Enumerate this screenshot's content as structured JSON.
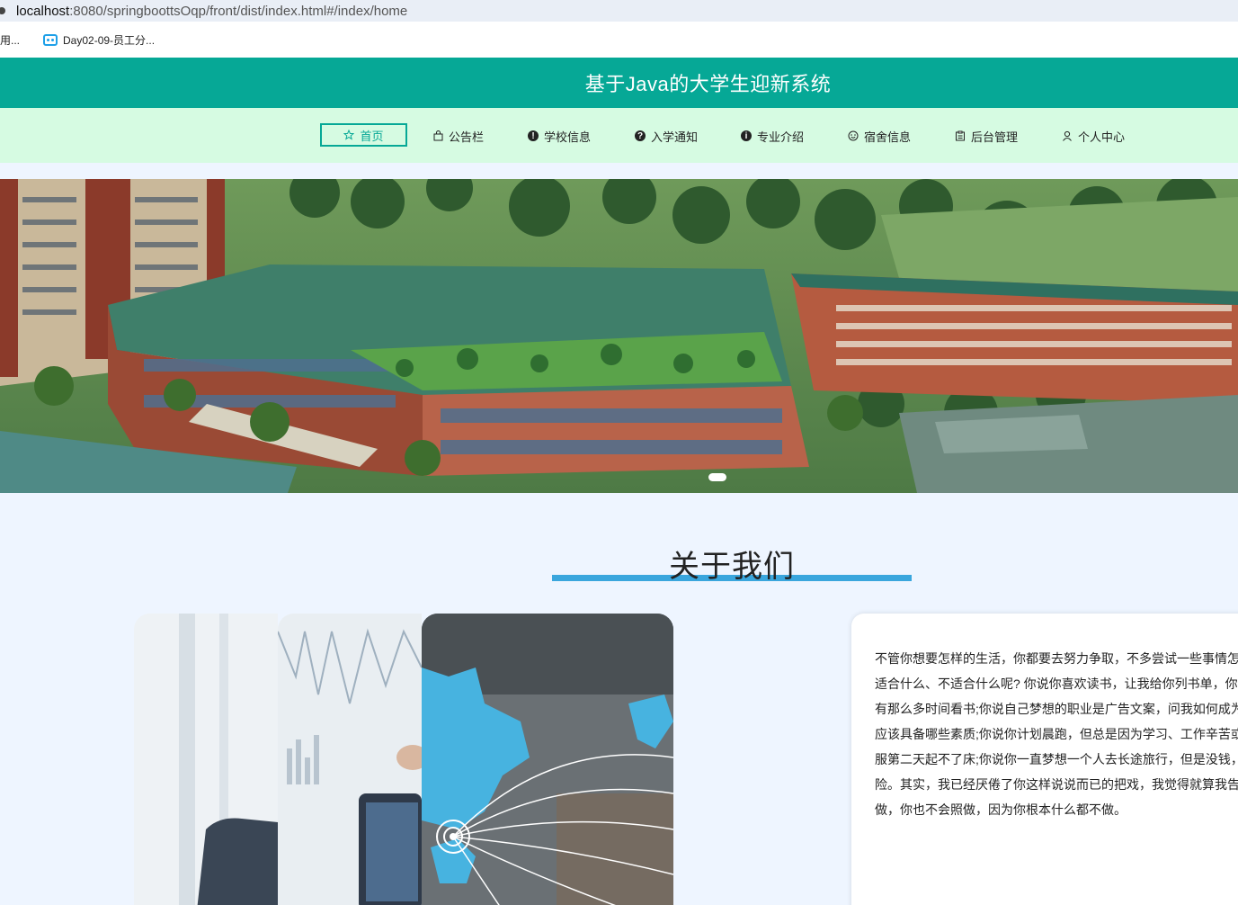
{
  "browser": {
    "url_host": "localhost",
    "url_rest": ":8080/springboottsOqp/front/dist/index.html#/index/home",
    "bookmarks": [
      "用...",
      "Day02-09-员工分..."
    ]
  },
  "header": {
    "title": "基于Java的大学生迎新系统"
  },
  "nav": {
    "items": [
      {
        "label": "首页",
        "icon": "star-icon",
        "active": true
      },
      {
        "label": "公告栏",
        "icon": "bag-icon"
      },
      {
        "label": "学校信息",
        "icon": "info-icon"
      },
      {
        "label": "入学通知",
        "icon": "question-icon"
      },
      {
        "label": "专业介绍",
        "icon": "info-icon"
      },
      {
        "label": "宿舍信息",
        "icon": "smile-icon"
      },
      {
        "label": "后台管理",
        "icon": "clipboard-icon"
      },
      {
        "label": "个人中心",
        "icon": "user-icon"
      }
    ]
  },
  "carousel": {
    "active_index": 0
  },
  "about": {
    "title": "关于我们",
    "text_lines": [
      "不管你想要怎样的生活，你都要去努力争取，不多尝试一些事情怎",
      "适合什么、不适合什么呢? 你说你喜欢读书，让我给你列书单，你",
      "有那么多时间看书;你说自己梦想的职业是广告文案，问我如何成为",
      "应该具备哪些素质;你说你计划晨跑，但总是因为学习、工作辛苦或",
      "服第二天起不了床;你说你一直梦想一个人去长途旅行，但是没钱，",
      "险。其实，我已经厌倦了你这样说说而已的把戏，我觉得就算我告",
      "做，你也不会照做，因为你根本什么都不做。"
    ]
  },
  "colors": {
    "header_bg": "#06a896",
    "nav_bg": "#d6fbe2",
    "accent_line": "#3aa6dd",
    "page_bg": "#eef5ff"
  }
}
